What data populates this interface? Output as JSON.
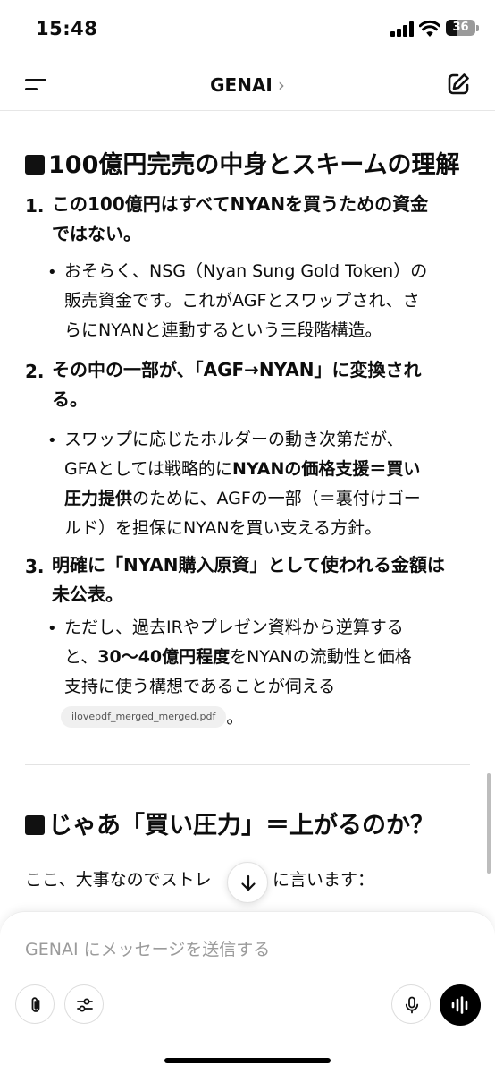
{
  "status_bar": {
    "time": "15:48",
    "battery": "36"
  },
  "header": {
    "title": "GENAI",
    "chevron": "›"
  },
  "section1": {
    "heading": "100億円完売の中身とスキームの理解",
    "items": [
      {
        "number": "1.",
        "title_lines": [
          "この100億円はすべてNYANを買うための資金",
          "ではない。"
        ],
        "bullet_lines": [
          "おそらく、NSG（Nyan Sung Gold Token）の",
          "販売資金です。これがAGFとスワップされ、さ",
          "らにNYANと連動するという三段階構造。"
        ]
      },
      {
        "number": "2.",
        "title_lines": [
          "その中の一部が、「AGF→NYAN」に変換され",
          "る。"
        ],
        "bullet_line1": "スワップに応じたホルダーの動き次第だが、",
        "bullet_line2_pre": "GFAとしては戦略的に",
        "bullet_line2_bold": "NYANの価格支援＝買い",
        "bullet_line3_bold": "圧力提供",
        "bullet_line3_post": "のために、AGFの一部（＝裏付けゴー",
        "bullet_line4": "ルド）を担保にNYANを買い支える方針。"
      },
      {
        "number": "3.",
        "title_lines": [
          "明確に「NYAN購入原資」として使われる金額は",
          "未公表。"
        ],
        "bullet_line1": "ただし、過去IRやプレゼン資料から逆算する",
        "bullet_line2_pre": "と、",
        "bullet_line2_bold": "30〜40億円程度",
        "bullet_line2_post": "をNYANの流動性と価格",
        "bullet_line3": "支持に使う構想であることが伺える",
        "citation": "ilovepdf_merged_merged.pdf",
        "after_citation": "。"
      }
    ]
  },
  "section2": {
    "heading": "じゃあ「買い圧力」＝上がるのか？",
    "paragraph_visible_left": "ここ、大事なのでストレ",
    "paragraph_visible_right": "に言います："
  },
  "composer": {
    "placeholder": "GENAI にメッセージを送信する"
  },
  "icons": [
    "menu-icon",
    "edit-icon",
    "scroll-down-icon",
    "paperclip-icon",
    "sliders-icon",
    "mic-icon",
    "voice-waveform-icon"
  ]
}
